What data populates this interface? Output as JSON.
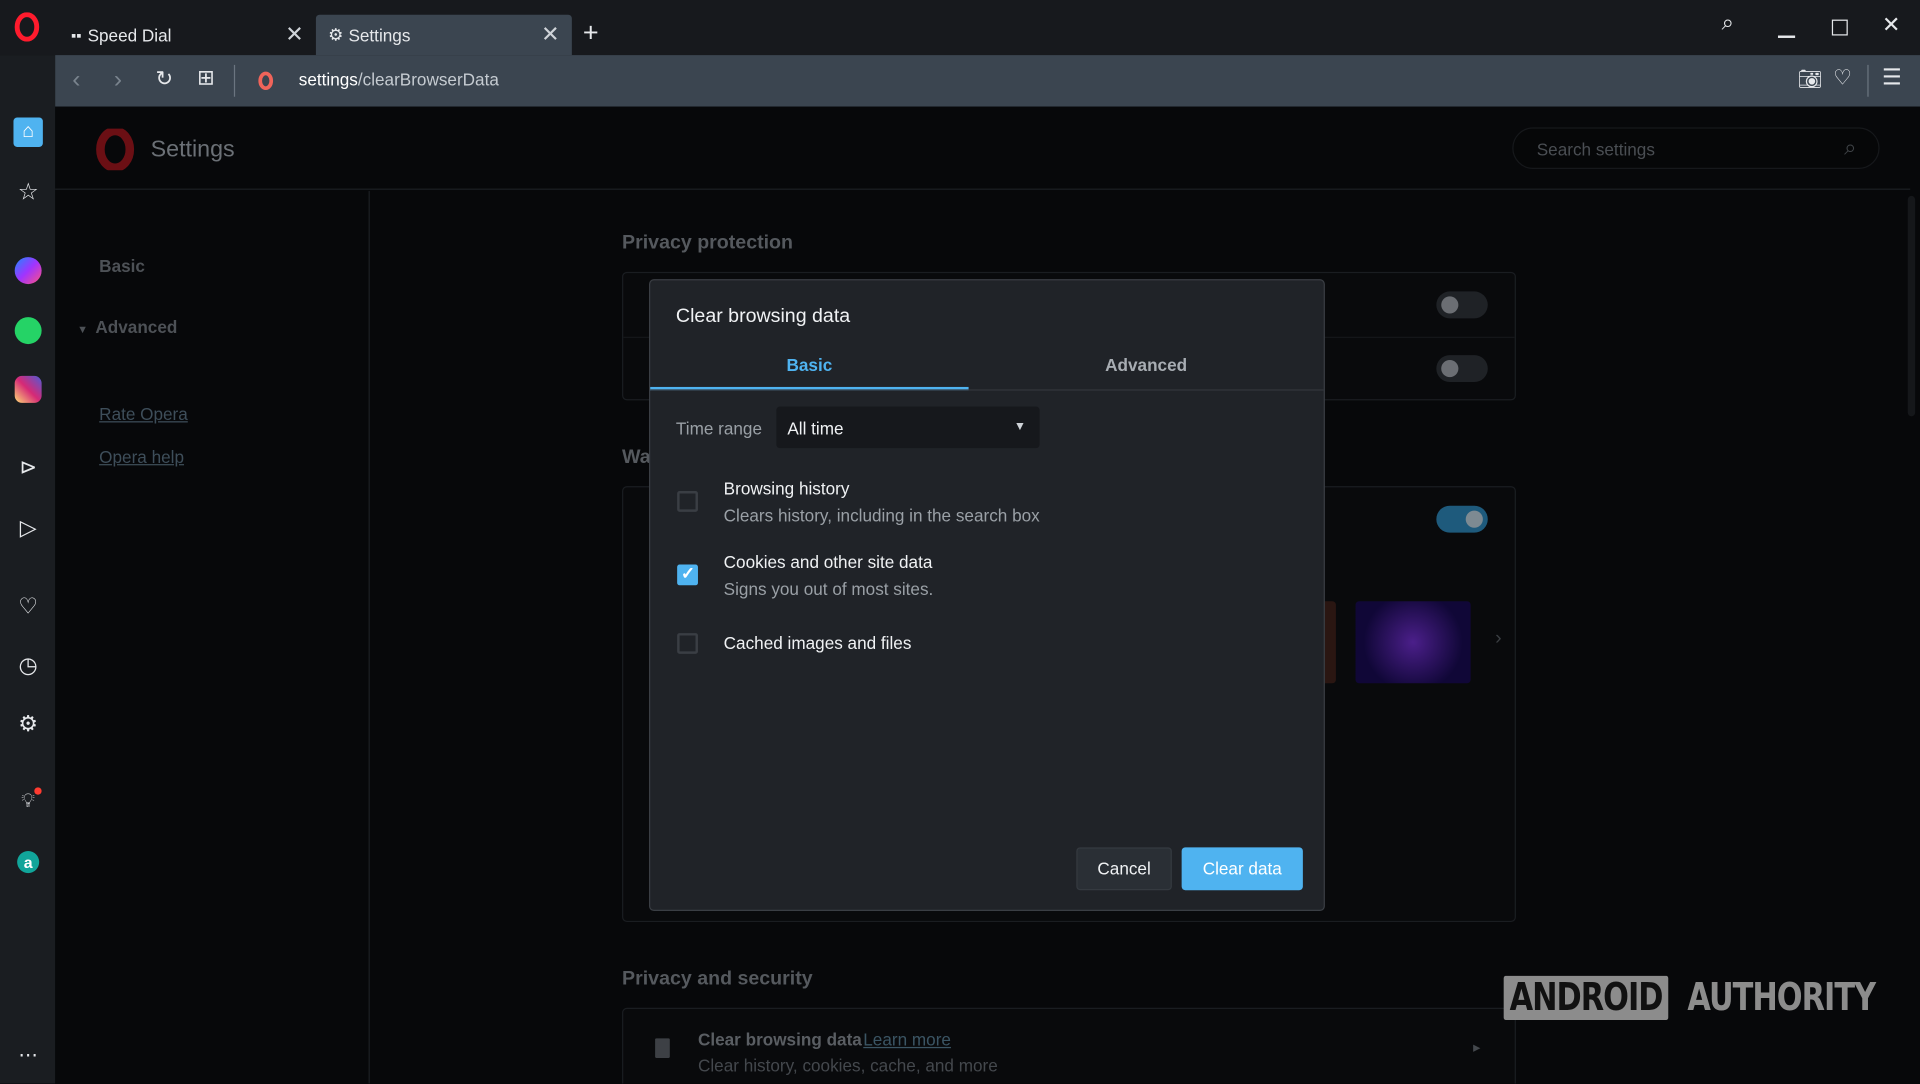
{
  "browser": {
    "tabs": [
      {
        "label": "Speed Dial",
        "icon": "speed-dial-icon",
        "active": false
      },
      {
        "label": "Settings",
        "icon": "gear-icon",
        "active": true
      }
    ],
    "address": {
      "host": "settings",
      "path": "/clearBrowserData"
    },
    "accent": "#4fb3f0"
  },
  "sidebar": {
    "icons": [
      "home-icon",
      "star-icon",
      "messenger-icon",
      "whatsapp-icon",
      "instagram-icon",
      "player-icon",
      "send-icon",
      "heart-icon",
      "history-icon",
      "settings-icon",
      "lightbulb-icon",
      "aria-icon",
      "more-icon"
    ]
  },
  "settings": {
    "title": "Settings",
    "search_placeholder": "Search settings",
    "nav": {
      "basic": "Basic",
      "advanced": "Advanced",
      "rate": "Rate Opera",
      "help": "Opera help"
    },
    "sections": {
      "privacy_protection": "Privacy protection",
      "wallpapers_partial": "Wa",
      "privacy_security": "Privacy and security"
    },
    "clear_row": {
      "title": "Clear browsing data",
      "learn_more": "Learn more",
      "subtitle": "Clear history, cookies, cache, and more"
    }
  },
  "dialog": {
    "title": "Clear browsing data",
    "tabs": [
      {
        "label": "Basic",
        "active": true
      },
      {
        "label": "Advanced",
        "active": false
      }
    ],
    "time_range_label": "Time range",
    "time_range_value": "All time",
    "options": [
      {
        "title": "Browsing history",
        "subtitle": "Clears history, including in the search box",
        "checked": false
      },
      {
        "title": "Cookies and other site data",
        "subtitle": "Signs you out of most sites.",
        "checked": true
      },
      {
        "title": "Cached images and files",
        "subtitle": "",
        "checked": false
      }
    ],
    "cancel": "Cancel",
    "confirm": "Clear data"
  },
  "watermark": {
    "part1": "ANDROID",
    "part2": "AUTHORITY"
  }
}
